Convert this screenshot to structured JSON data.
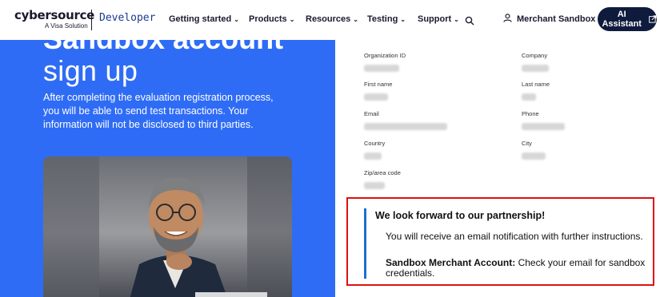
{
  "header": {
    "logo_main": "cybersource",
    "logo_sub": "A Visa Solution",
    "logo_product": "Developer",
    "nav": [
      {
        "label": "Getting started"
      },
      {
        "label": "Products"
      },
      {
        "label": "Resources"
      },
      {
        "label": "Testing"
      },
      {
        "label": "Support"
      }
    ],
    "merchant_label": "Merchant Sandbox",
    "ai_label": "AI Assistant"
  },
  "hero": {
    "title_cut": "Sandbox account",
    "title": "sign up",
    "text": "After completing the evaluation registration process, you will be able to send test transactions. Your information will not be disclosed to third parties."
  },
  "form": {
    "fields": [
      {
        "label": "Organization ID"
      },
      {
        "label": "Company"
      },
      {
        "label": "First name"
      },
      {
        "label": "Last name"
      },
      {
        "label": "Email"
      },
      {
        "label": "Phone"
      },
      {
        "label": "Country"
      },
      {
        "label": "City"
      },
      {
        "label": "Zip/area code"
      }
    ]
  },
  "message": {
    "title": "We look forward to our partnership!",
    "line1": "You will receive an email notification with further instructions.",
    "line2_bold": "Sandbox Merchant Account:",
    "line2_rest": " Check your email for sandbox credentials."
  },
  "colors": {
    "hero_blue": "#2f6cf6",
    "navy": "#0f1b3d",
    "accent_bar": "#1d6fd0",
    "highlight_border": "#dd1111"
  }
}
